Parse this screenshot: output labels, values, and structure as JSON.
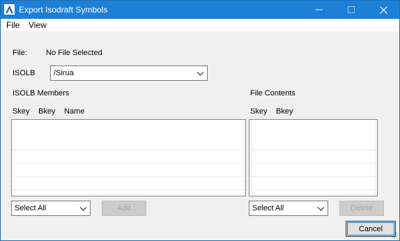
{
  "window": {
    "title": "Export Isodraft Symbols"
  },
  "menu": [
    "File",
    "View"
  ],
  "file": {
    "label": "File:",
    "value": "No File Selected"
  },
  "isolb": {
    "label": "ISOLB",
    "selected": "/Sirua"
  },
  "members": {
    "section_label": "ISOLB Members",
    "columns": [
      "Skey",
      "Bkey",
      "Name"
    ],
    "select_value": "Select All",
    "add_label": "Add"
  },
  "contents": {
    "section_label": "File Contents",
    "columns": [
      "Skey",
      "Bkey"
    ],
    "select_value": "Select All",
    "delete_label": "Delete"
  },
  "cancel_label": "Cancel"
}
